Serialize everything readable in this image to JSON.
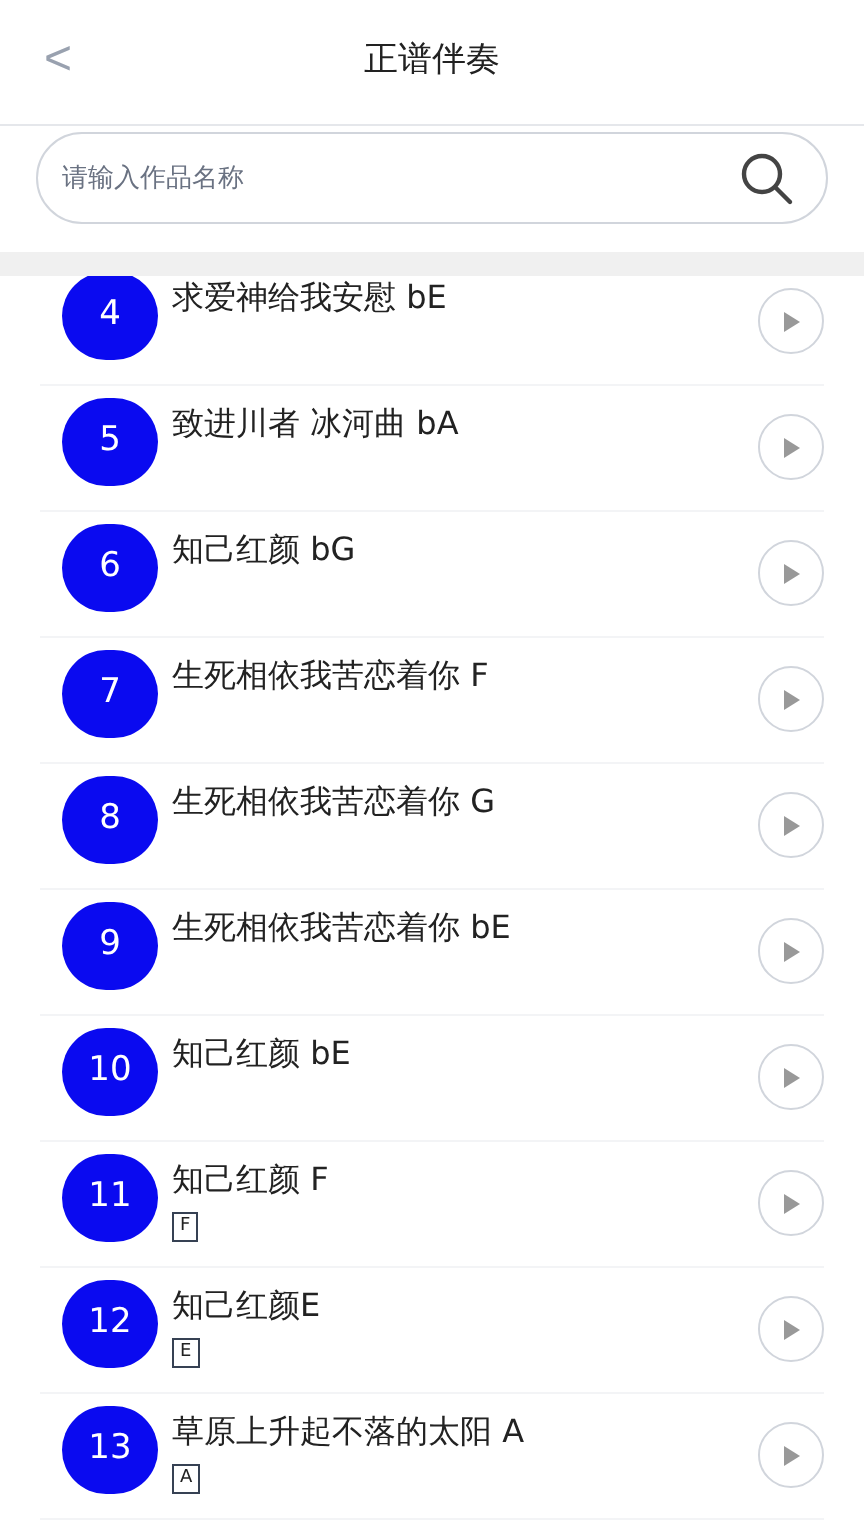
{
  "header": {
    "back": "<",
    "title": "正谱伴奏"
  },
  "search": {
    "placeholder": "请输入作品名称"
  },
  "songs": [
    {
      "number": "4",
      "title": "求爱神给我安慰 bE"
    },
    {
      "number": "5",
      "title": "致进川者 冰河曲 bA"
    },
    {
      "number": "6",
      "title": "知己红颜 bG"
    },
    {
      "number": "7",
      "title": "生死相依我苦恋着你 F"
    },
    {
      "number": "8",
      "title": "生死相依我苦恋着你 G"
    },
    {
      "number": "9",
      "title": "生死相依我苦恋着你 bE"
    },
    {
      "number": "10",
      "title": "知己红颜 bE"
    },
    {
      "number": "11",
      "title": "知己红颜 F",
      "tag": "F"
    },
    {
      "number": "12",
      "title": "知己红颜E",
      "tag": "E"
    },
    {
      "number": "13",
      "title": "草原上升起不落的太阳 A",
      "tag": "A"
    }
  ]
}
